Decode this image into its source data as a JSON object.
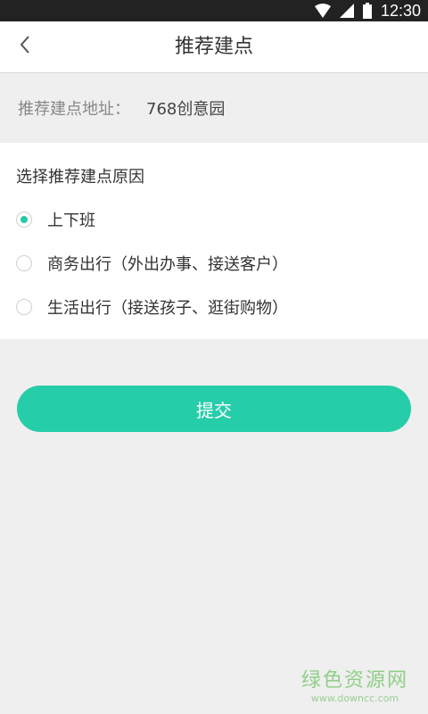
{
  "status": {
    "time": "12:30"
  },
  "nav": {
    "title": "推荐建点"
  },
  "address": {
    "label": "推荐建点地址：",
    "value": "768创意园"
  },
  "reason": {
    "title": "选择推荐建点原因",
    "options": [
      {
        "label": "上下班",
        "checked": true
      },
      {
        "label": "商务出行（外出办事、接送客户）",
        "checked": false
      },
      {
        "label": "生活出行（接送孩子、逛街购物）",
        "checked": false
      }
    ]
  },
  "submit": {
    "label": "提交"
  },
  "watermark": {
    "main": "绿色资源网",
    "sub": "www.downcc.com"
  },
  "colors": {
    "accent": "#26cda9",
    "background": "#efefef"
  }
}
